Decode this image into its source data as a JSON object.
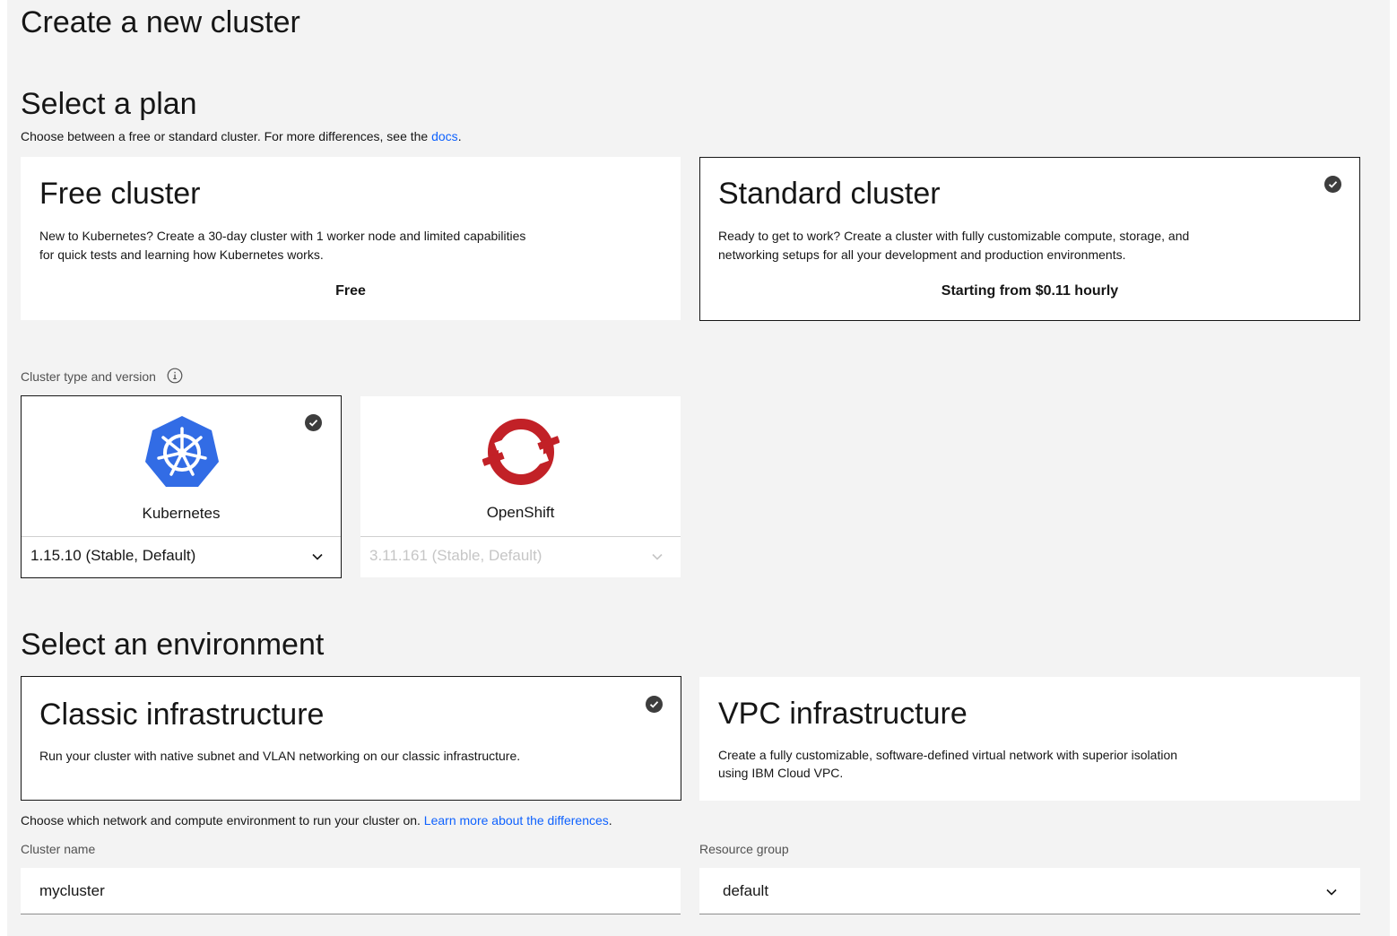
{
  "page": {
    "title": "Create a new cluster"
  },
  "plan": {
    "heading": "Select a plan",
    "subtitle_prefix": "Choose between a free or standard cluster. For more differences, see the ",
    "subtitle_link": "docs",
    "subtitle_suffix": ".",
    "tiles": [
      {
        "title": "Free cluster",
        "desc_line1": "New to Kubernetes? Create a 30-day cluster with 1 worker node and limited capabilities",
        "desc_line2": "for quick tests and learning how Kubernetes works.",
        "price": "Free",
        "selected": false
      },
      {
        "title": "Standard cluster",
        "desc_line1": "Ready to get to work? Create a cluster with fully customizable compute, storage, and",
        "desc_line2": "networking setups for all your development and production environments.",
        "price": "Starting from $0.11 hourly",
        "selected": true
      }
    ]
  },
  "cluster_type": {
    "label": "Cluster type and version",
    "options": [
      {
        "name": "Kubernetes",
        "icon": "kubernetes-logo-icon",
        "version": "1.15.10 (Stable, Default)",
        "selected": true,
        "enabled": true
      },
      {
        "name": "OpenShift",
        "icon": "openshift-logo-icon",
        "version": "3.11.161 (Stable, Default)",
        "selected": false,
        "enabled": false
      }
    ]
  },
  "environment": {
    "heading": "Select an environment",
    "tiles": [
      {
        "title": "Classic infrastructure",
        "desc_line1": "Run your cluster with native subnet and VLAN networking on our classic infrastructure.",
        "desc_line2": "",
        "selected": true
      },
      {
        "title": "VPC infrastructure",
        "desc_line1": "Create a fully customizable, software-defined virtual network with superior isolation",
        "desc_line2": "using IBM Cloud VPC.",
        "selected": false
      }
    ],
    "note_prefix": "Choose which network and compute environment to run your cluster on. ",
    "note_link": "Learn more about the differences",
    "note_suffix": "."
  },
  "form": {
    "cluster_name_label": "Cluster name",
    "cluster_name_value": "mycluster",
    "resource_group_label": "Resource group",
    "resource_group_value": "default"
  },
  "colors": {
    "background": "#f3f3f3",
    "tile": "#ffffff",
    "link": "#0f62fe",
    "kubernetes_blue": "#326ce5",
    "openshift_red": "#c22127"
  }
}
